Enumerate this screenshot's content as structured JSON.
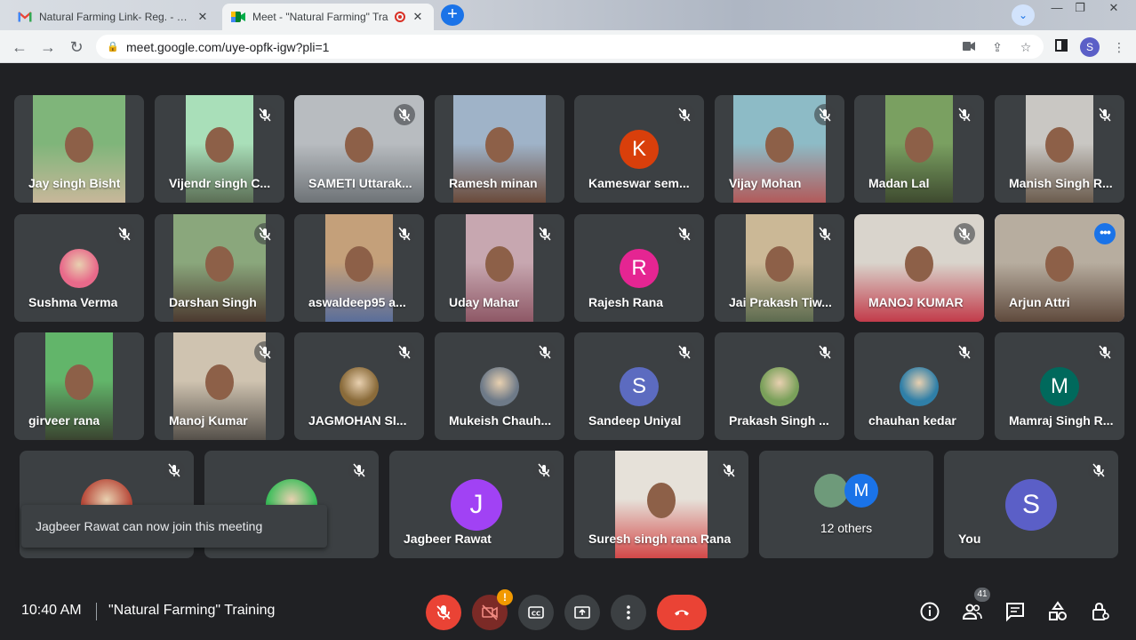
{
  "browser": {
    "tabs": [
      {
        "title": "Natural Farming Link- Reg. - sam",
        "favicon": "gmail-icon",
        "active": false
      },
      {
        "title": "Meet - \"Natural Farming\" Tra",
        "favicon": "meet-icon",
        "active": true
      }
    ],
    "url": "meet.google.com/uye-opfk-igw?pli=1",
    "profile_initial": "S"
  },
  "participants": [
    {
      "name": "Jay singh Bisht",
      "muted": false
    },
    {
      "name": "Vijendr singh C...",
      "muted": true
    },
    {
      "name": "SAMETI Uttarak...",
      "muted": true
    },
    {
      "name": "Ramesh minan",
      "muted": false
    },
    {
      "name": "Kameswar sem...",
      "muted": true,
      "initial": "K",
      "avatar_color": "#d93f0b"
    },
    {
      "name": "Vijay Mohan",
      "muted": true
    },
    {
      "name": "Madan Lal",
      "muted": true
    },
    {
      "name": "Manish Singh R...",
      "muted": true
    },
    {
      "name": "Sushma Verma",
      "muted": true
    },
    {
      "name": "Darshan Singh",
      "muted": true
    },
    {
      "name": "aswaldeep95 a...",
      "muted": true
    },
    {
      "name": "Uday Mahar",
      "muted": true
    },
    {
      "name": "Rajesh Rana",
      "muted": true,
      "initial": "R",
      "avatar_color": "#e52592"
    },
    {
      "name": "Jai Prakash Tiw...",
      "muted": true
    },
    {
      "name": "MANOJ KUMAR",
      "muted": true
    },
    {
      "name": "Arjun Attri",
      "muted": false,
      "speaking": true
    },
    {
      "name": "girveer rana",
      "muted": false
    },
    {
      "name": "Manoj Kumar",
      "muted": true
    },
    {
      "name": "JAGMOHAN SI...",
      "muted": true
    },
    {
      "name": "Mukeish Chauh...",
      "muted": true
    },
    {
      "name": "Sandeep Uniyal",
      "muted": true,
      "initial": "S",
      "avatar_color": "#5c6bc0"
    },
    {
      "name": "Prakash Singh ...",
      "muted": true
    },
    {
      "name": "chauhan kedar",
      "muted": true
    },
    {
      "name": "Mamraj Singh R...",
      "muted": true,
      "initial": "M",
      "avatar_color": "#00695c"
    },
    {
      "name": "",
      "muted": true
    },
    {
      "name": "",
      "muted": true
    },
    {
      "name": "Jagbeer Rawat",
      "muted": true,
      "initial": "J",
      "avatar_color": "#a142f4"
    },
    {
      "name": "Suresh singh rana Rana",
      "muted": true
    },
    {
      "name": "12 others",
      "muted": false,
      "others_initial": "M",
      "avatar_color": "#1a73e8"
    },
    {
      "name": "You",
      "muted": true,
      "initial": "S",
      "avatar_color": "#5b5fc7"
    }
  ],
  "toast": "Jagbeer Rawat can now join this meeting",
  "footer": {
    "time": "10:40 AM",
    "meeting_title": "\"Natural Farming\" Training",
    "warning_badge": "!",
    "participant_count": "41"
  },
  "colors": {
    "background": "#202124",
    "tile": "#3c4043",
    "end_call": "#ea4335",
    "accent": "#8ab4f8"
  }
}
